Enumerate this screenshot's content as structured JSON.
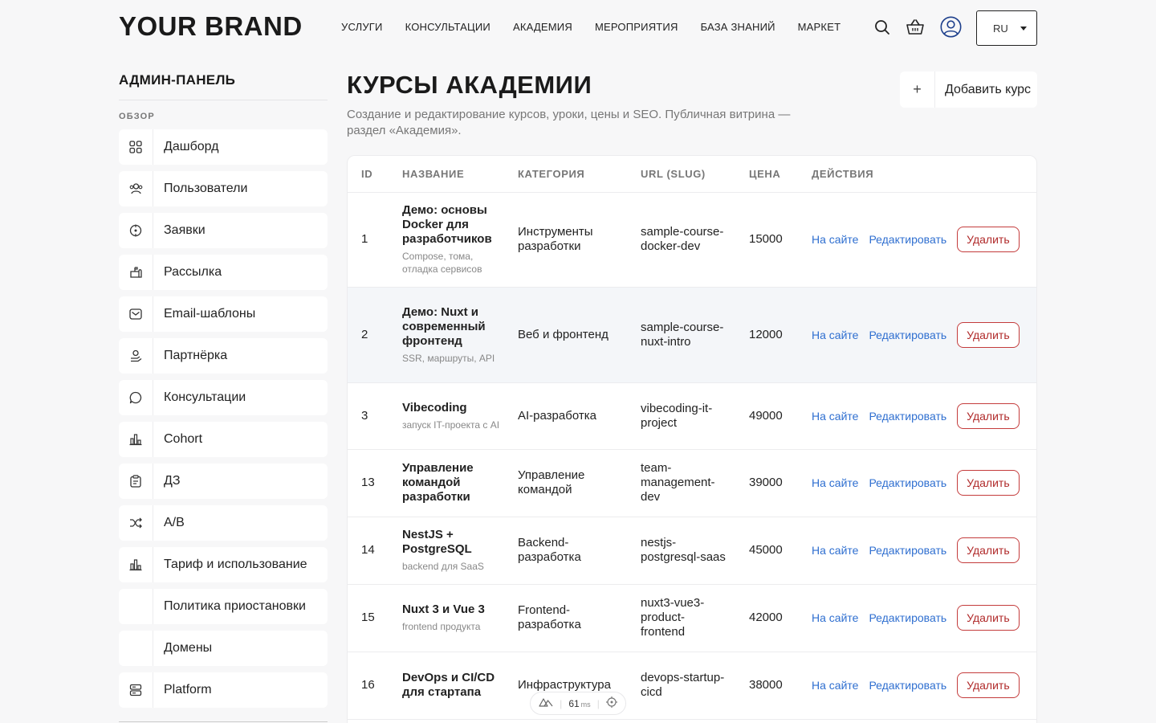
{
  "header": {
    "brand": "YOUR BRAND",
    "nav": [
      "УСЛУГИ",
      "КОНСУЛЬТАЦИИ",
      "АКАДЕМИЯ",
      "МЕРОПРИЯТИЯ",
      "БАЗА ЗНАНИЙ",
      "МАРКЕТ"
    ],
    "icons": [
      "search-icon",
      "basket-icon",
      "user-icon"
    ],
    "lang": "RU"
  },
  "sidebar": {
    "title": "АДМИН-ПАНЕЛЬ",
    "section": "ОБЗОР",
    "items": [
      {
        "label": "Дашборд",
        "icon": "dashboard-icon"
      },
      {
        "label": "Пользователи",
        "icon": "users-icon"
      },
      {
        "label": "Заявки",
        "icon": "target-icon"
      },
      {
        "label": "Рассылка",
        "icon": "mailbox-icon"
      },
      {
        "label": "Email-шаблоны",
        "icon": "envelope-icon"
      },
      {
        "label": "Партнёрка",
        "icon": "partner-icon"
      },
      {
        "label": "Консультации",
        "icon": "chat-bubble-icon"
      },
      {
        "label": "Cohort",
        "icon": "bar-chart-icon"
      },
      {
        "label": "ДЗ",
        "icon": "clipboard-icon"
      },
      {
        "label": "A/B",
        "icon": "shuffle-icon"
      },
      {
        "label": "Тариф и использование",
        "icon": "bar-chart-icon"
      },
      {
        "label": "Политика приостановки",
        "icon": ""
      },
      {
        "label": "Домены",
        "icon": ""
      },
      {
        "label": "Platform",
        "icon": "server-icon"
      }
    ]
  },
  "main": {
    "title": "КУРСЫ АКАДЕМИИ",
    "subtitle": "Создание и редактирование курсов, уроки, цены и SEO. Публичная витрина — раздел «Академия».",
    "add_button": "Добавить курс",
    "columns": [
      "ID",
      "НАЗВАНИЕ",
      "КАТЕГОРИЯ",
      "URL (SLUG)",
      "ЦЕНА",
      "ДЕЙСТВИЯ"
    ],
    "actions": {
      "view": "На сайте",
      "edit": "Редактировать",
      "delete": "Удалить"
    },
    "rows": [
      {
        "id": "1",
        "name": "Демо: основы Docker для разработчиков",
        "desc": "Compose, тома, отладка сервисов",
        "category": "Инструменты разработки",
        "slug": "sample-course-docker-dev",
        "price": "15000"
      },
      {
        "id": "2",
        "name": "Демо: Nuxt и современный фронтенд",
        "desc": "SSR, маршруты, API",
        "category": "Веб и фронтенд",
        "slug": "sample-course-nuxt-intro",
        "price": "12000"
      },
      {
        "id": "3",
        "name": "Vibecoding",
        "desc": "запуск IT-проекта с AI",
        "category": "AI-разработка",
        "slug": "vibecoding-it-project",
        "price": "49000"
      },
      {
        "id": "13",
        "name": "Управление командой разработки",
        "desc": "",
        "category": "Управление командой",
        "slug": "team-management-dev",
        "price": "39000"
      },
      {
        "id": "14",
        "name": "NestJS + PostgreSQL",
        "desc": "backend для SaaS",
        "category": "Backend-разработка",
        "slug": "nestjs-postgresql-saas",
        "price": "45000"
      },
      {
        "id": "15",
        "name": "Nuxt 3 и Vue 3",
        "desc": "frontend продукта",
        "category": "Frontend-разработка",
        "slug": "nuxt3-vue3-product-frontend",
        "price": "42000"
      },
      {
        "id": "16",
        "name": "DevOps и CI/CD для стартапа",
        "desc": "",
        "category": "Инфраструктура",
        "slug": "devops-startup-cicd",
        "price": "38000"
      }
    ]
  },
  "perf_badge": {
    "value": "61",
    "unit": "ms"
  }
}
